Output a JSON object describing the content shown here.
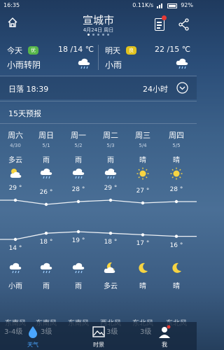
{
  "status": {
    "time": "16:35",
    "network": "0.11K/s",
    "battery": "92%"
  },
  "header": {
    "city": "宣城市",
    "date": "4月24日 周日"
  },
  "today": {
    "label": "今天",
    "aqi": "优",
    "temp": "18 /14 ℃",
    "condition": "小雨转阴",
    "icon": "rain-cloud-icon"
  },
  "tomorrow": {
    "label": "明天",
    "aqi": "良",
    "temp": "22 /15 ℃",
    "condition": "小雨",
    "icon": "rain-cloud-icon"
  },
  "sunset": {
    "text": "日落 18:39",
    "hours_label": "24小时"
  },
  "forecast": {
    "title": "15天预报",
    "days": [
      {
        "week": "周六",
        "date": "4/30",
        "day_cond": "多云",
        "day_icon": "partly-cloudy-icon",
        "high": "29 °",
        "low": "14 °",
        "night_icon": "rain-cloud-icon",
        "night_cond": "小雨",
        "wind": "东南风"
      },
      {
        "week": "周日",
        "date": "5/1",
        "day_cond": "雨",
        "day_icon": "rain-cloud-icon",
        "high": "26 °",
        "low": "18 °",
        "night_icon": "rain-cloud-icon",
        "night_cond": "雨",
        "wind": "东南风"
      },
      {
        "week": "周一",
        "date": "5/2",
        "day_cond": "雨",
        "day_icon": "rain-cloud-icon",
        "high": "28 °",
        "low": "19 °",
        "night_icon": "rain-cloud-icon",
        "night_cond": "雨",
        "wind": "东南风"
      },
      {
        "week": "周二",
        "date": "5/3",
        "day_cond": "雨",
        "day_icon": "rain-cloud-icon",
        "high": "29 °",
        "low": "18 °",
        "night_icon": "partly-cloudy-night-icon",
        "night_cond": "多云",
        "wind": "西北风"
      },
      {
        "week": "周三",
        "date": "5/4",
        "day_cond": "晴",
        "day_icon": "sun-icon",
        "high": "27 °",
        "low": "17 °",
        "night_icon": "moon-icon",
        "night_cond": "晴",
        "wind": "东北风"
      },
      {
        "week": "周四",
        "date": "5/5",
        "day_cond": "晴",
        "day_icon": "sun-icon",
        "high": "28 °",
        "low": "16 °",
        "night_icon": "moon-icon",
        "night_cond": "晴",
        "wind": "东北风"
      }
    ]
  },
  "tabs": [
    {
      "label": "天气",
      "icon": "weather-drop-icon",
      "active": true
    },
    {
      "label": "时景",
      "icon": "photo-icon",
      "active": false
    },
    {
      "label": "我",
      "icon": "profile-icon",
      "active": false
    }
  ],
  "tabbar_overlay": [
    "3-4级",
    "3级",
    "3级",
    "3级"
  ],
  "colors": {
    "accent": "#4aa6ff",
    "aqi_good": "#57b64a",
    "aqi_ok": "#e0c21f",
    "notify": "#e53935"
  }
}
